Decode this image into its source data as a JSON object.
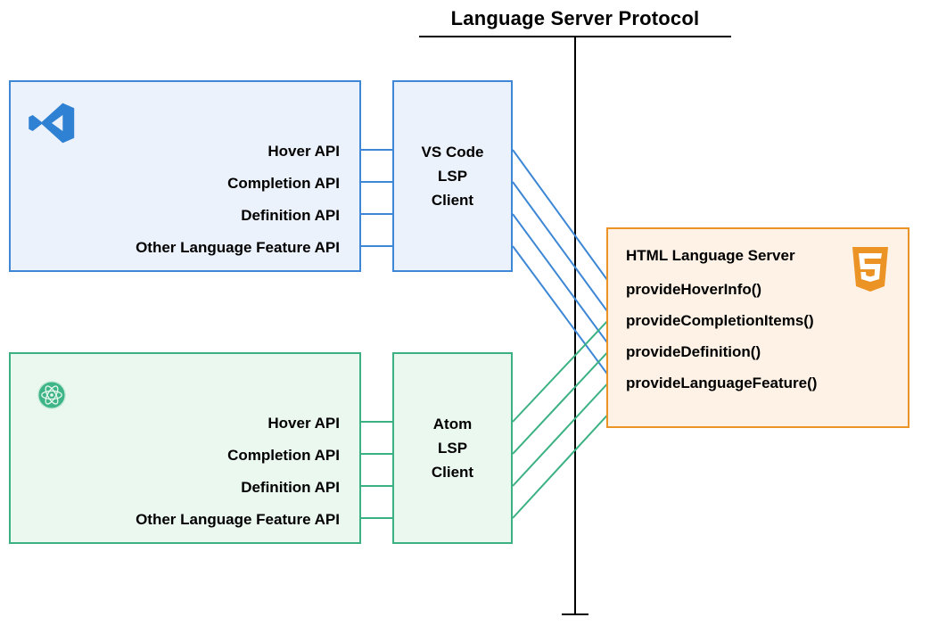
{
  "title": "Language Server Protocol",
  "editors": {
    "vscode": {
      "apis": [
        "Hover API",
        "Completion API",
        "Definition API",
        "Other Language Feature API"
      ],
      "client_lines": [
        "VS Code",
        "LSP",
        "Client"
      ],
      "color": "#3d87d6",
      "bg": "#ecf2fb",
      "icon": "vscode-icon"
    },
    "atom": {
      "apis": [
        "Hover API",
        "Completion API",
        "Definition API",
        "Other Language Feature API"
      ],
      "client_lines": [
        "Atom",
        "LSP",
        "Client"
      ],
      "color": "#3bb183",
      "bg": "#eaf8ef",
      "icon": "atom-icon"
    }
  },
  "server": {
    "title": "HTML Language Server",
    "methods": [
      "provideHoverInfo()",
      "provideCompletionItems()",
      "provideDefinition()",
      "provideLanguageFeature()"
    ],
    "icon": "html5-icon",
    "color": "#ec9326",
    "bg": "#fdf2e5"
  }
}
